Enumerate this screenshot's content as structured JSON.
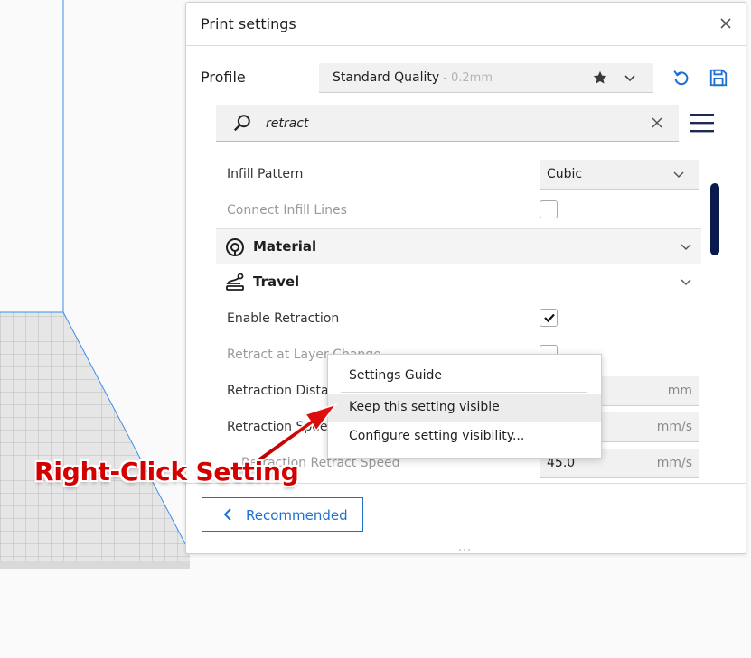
{
  "panel": {
    "title": "Print settings",
    "profile_label": "Profile",
    "profile_name": "Standard Quality",
    "profile_sub": "- 0.2mm"
  },
  "search": {
    "value": "retract"
  },
  "settings": {
    "infill_pattern": {
      "label": "Infill Pattern",
      "value": "Cubic"
    },
    "connect_infill_lines": {
      "label": "Connect Infill Lines",
      "checked": false
    },
    "material_category": "Material",
    "travel_category": "Travel",
    "enable_retraction": {
      "label": "Enable Retraction",
      "checked": true
    },
    "retract_at_layer_change": {
      "label": "Retract at Layer Change",
      "checked": false
    },
    "retraction_distance": {
      "label": "Retraction Distance",
      "unit": "mm"
    },
    "retraction_speed": {
      "label": "Retraction Speed",
      "unit": "mm/s"
    },
    "retraction_retract_speed": {
      "label": "Retraction Retract Speed",
      "value": "45.0",
      "unit": "mm/s"
    }
  },
  "footer": {
    "recommended_label": "Recommended"
  },
  "context_menu": {
    "items": [
      "Settings Guide",
      "Keep this setting visible",
      "Configure setting visibility..."
    ],
    "highlighted": "Keep this setting visible"
  },
  "annotation": {
    "text": "Right-Click Setting",
    "color": "#d40000"
  },
  "colors": {
    "accent": "#1f6fd1",
    "scrollbar": "#0a1a4a",
    "build_plate_edge": "#3b8ee8"
  },
  "icons": [
    "close-icon",
    "star-icon",
    "chevron-down-icon",
    "reset-icon",
    "save-icon",
    "search-icon",
    "clear-icon",
    "hamburger-menu-icon",
    "material-spool-icon",
    "travel-icon",
    "check-icon",
    "chevron-left-icon"
  ]
}
